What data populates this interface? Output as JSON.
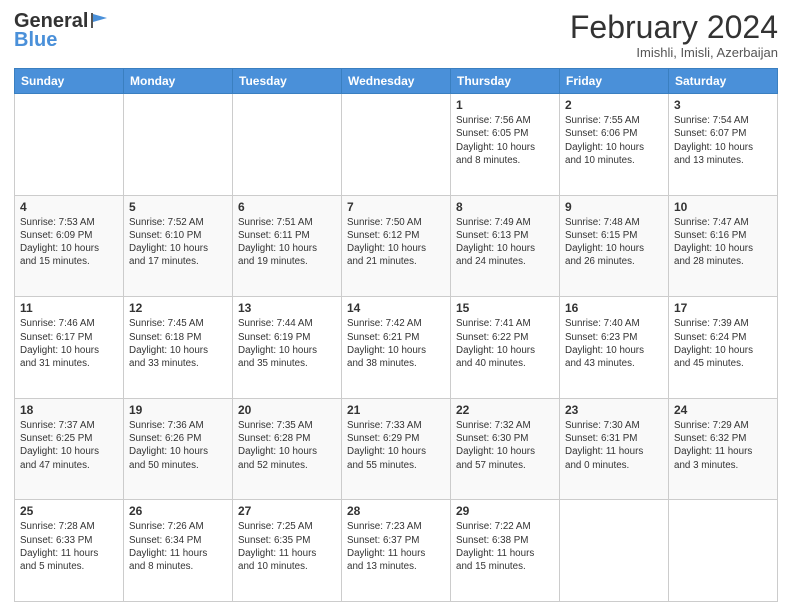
{
  "logo": {
    "text_general": "General",
    "text_blue": "Blue"
  },
  "header": {
    "month": "February 2024",
    "location": "Imishli, Imisli, Azerbaijan"
  },
  "weekdays": [
    "Sunday",
    "Monday",
    "Tuesday",
    "Wednesday",
    "Thursday",
    "Friday",
    "Saturday"
  ],
  "weeks": [
    [
      {
        "day": "",
        "info": ""
      },
      {
        "day": "",
        "info": ""
      },
      {
        "day": "",
        "info": ""
      },
      {
        "day": "",
        "info": ""
      },
      {
        "day": "1",
        "info": "Sunrise: 7:56 AM\nSunset: 6:05 PM\nDaylight: 10 hours\nand 8 minutes."
      },
      {
        "day": "2",
        "info": "Sunrise: 7:55 AM\nSunset: 6:06 PM\nDaylight: 10 hours\nand 10 minutes."
      },
      {
        "day": "3",
        "info": "Sunrise: 7:54 AM\nSunset: 6:07 PM\nDaylight: 10 hours\nand 13 minutes."
      }
    ],
    [
      {
        "day": "4",
        "info": "Sunrise: 7:53 AM\nSunset: 6:09 PM\nDaylight: 10 hours\nand 15 minutes."
      },
      {
        "day": "5",
        "info": "Sunrise: 7:52 AM\nSunset: 6:10 PM\nDaylight: 10 hours\nand 17 minutes."
      },
      {
        "day": "6",
        "info": "Sunrise: 7:51 AM\nSunset: 6:11 PM\nDaylight: 10 hours\nand 19 minutes."
      },
      {
        "day": "7",
        "info": "Sunrise: 7:50 AM\nSunset: 6:12 PM\nDaylight: 10 hours\nand 21 minutes."
      },
      {
        "day": "8",
        "info": "Sunrise: 7:49 AM\nSunset: 6:13 PM\nDaylight: 10 hours\nand 24 minutes."
      },
      {
        "day": "9",
        "info": "Sunrise: 7:48 AM\nSunset: 6:15 PM\nDaylight: 10 hours\nand 26 minutes."
      },
      {
        "day": "10",
        "info": "Sunrise: 7:47 AM\nSunset: 6:16 PM\nDaylight: 10 hours\nand 28 minutes."
      }
    ],
    [
      {
        "day": "11",
        "info": "Sunrise: 7:46 AM\nSunset: 6:17 PM\nDaylight: 10 hours\nand 31 minutes."
      },
      {
        "day": "12",
        "info": "Sunrise: 7:45 AM\nSunset: 6:18 PM\nDaylight: 10 hours\nand 33 minutes."
      },
      {
        "day": "13",
        "info": "Sunrise: 7:44 AM\nSunset: 6:19 PM\nDaylight: 10 hours\nand 35 minutes."
      },
      {
        "day": "14",
        "info": "Sunrise: 7:42 AM\nSunset: 6:21 PM\nDaylight: 10 hours\nand 38 minutes."
      },
      {
        "day": "15",
        "info": "Sunrise: 7:41 AM\nSunset: 6:22 PM\nDaylight: 10 hours\nand 40 minutes."
      },
      {
        "day": "16",
        "info": "Sunrise: 7:40 AM\nSunset: 6:23 PM\nDaylight: 10 hours\nand 43 minutes."
      },
      {
        "day": "17",
        "info": "Sunrise: 7:39 AM\nSunset: 6:24 PM\nDaylight: 10 hours\nand 45 minutes."
      }
    ],
    [
      {
        "day": "18",
        "info": "Sunrise: 7:37 AM\nSunset: 6:25 PM\nDaylight: 10 hours\nand 47 minutes."
      },
      {
        "day": "19",
        "info": "Sunrise: 7:36 AM\nSunset: 6:26 PM\nDaylight: 10 hours\nand 50 minutes."
      },
      {
        "day": "20",
        "info": "Sunrise: 7:35 AM\nSunset: 6:28 PM\nDaylight: 10 hours\nand 52 minutes."
      },
      {
        "day": "21",
        "info": "Sunrise: 7:33 AM\nSunset: 6:29 PM\nDaylight: 10 hours\nand 55 minutes."
      },
      {
        "day": "22",
        "info": "Sunrise: 7:32 AM\nSunset: 6:30 PM\nDaylight: 10 hours\nand 57 minutes."
      },
      {
        "day": "23",
        "info": "Sunrise: 7:30 AM\nSunset: 6:31 PM\nDaylight: 11 hours\nand 0 minutes."
      },
      {
        "day": "24",
        "info": "Sunrise: 7:29 AM\nSunset: 6:32 PM\nDaylight: 11 hours\nand 3 minutes."
      }
    ],
    [
      {
        "day": "25",
        "info": "Sunrise: 7:28 AM\nSunset: 6:33 PM\nDaylight: 11 hours\nand 5 minutes."
      },
      {
        "day": "26",
        "info": "Sunrise: 7:26 AM\nSunset: 6:34 PM\nDaylight: 11 hours\nand 8 minutes."
      },
      {
        "day": "27",
        "info": "Sunrise: 7:25 AM\nSunset: 6:35 PM\nDaylight: 11 hours\nand 10 minutes."
      },
      {
        "day": "28",
        "info": "Sunrise: 7:23 AM\nSunset: 6:37 PM\nDaylight: 11 hours\nand 13 minutes."
      },
      {
        "day": "29",
        "info": "Sunrise: 7:22 AM\nSunset: 6:38 PM\nDaylight: 11 hours\nand 15 minutes."
      },
      {
        "day": "",
        "info": ""
      },
      {
        "day": "",
        "info": ""
      }
    ]
  ]
}
